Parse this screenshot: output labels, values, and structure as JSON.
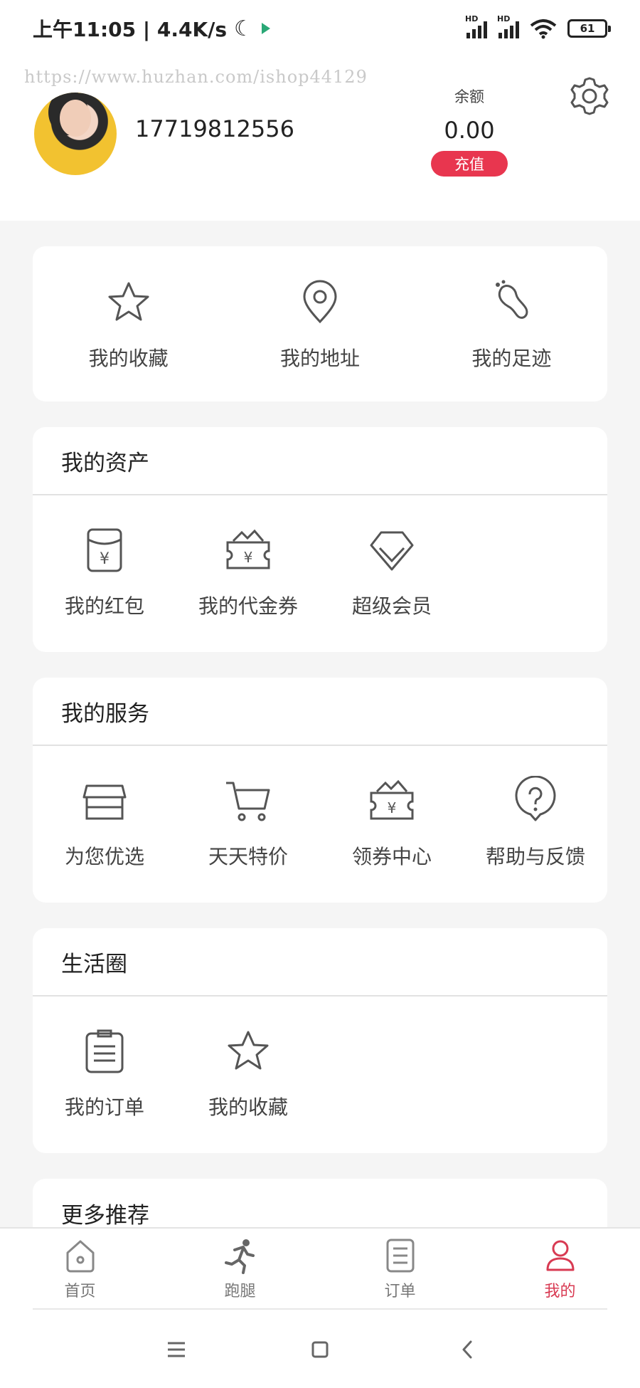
{
  "status_bar": {
    "time_speed": "上午11:05 | 4.4K/s",
    "moon_glyph": "☾",
    "battery": "61"
  },
  "watermark": "https://www.huzhan.com/ishop44129",
  "profile": {
    "phone": "17719812556",
    "balance_label": "余额",
    "balance_value": "0.00",
    "recharge_label": "充值"
  },
  "quick_links": [
    {
      "label": "我的收藏",
      "icon": "star-icon"
    },
    {
      "label": "我的地址",
      "icon": "location-pin-icon"
    },
    {
      "label": "我的足迹",
      "icon": "footprint-icon"
    }
  ],
  "assets": {
    "title": "我的资产",
    "items": [
      {
        "label": "我的红包",
        "icon": "red-packet-icon"
      },
      {
        "label": "我的代金券",
        "icon": "voucher-icon"
      },
      {
        "label": "超级会员",
        "icon": "diamond-icon"
      }
    ]
  },
  "services": {
    "title": "我的服务",
    "items": [
      {
        "label": "为您优选",
        "icon": "store-icon"
      },
      {
        "label": "天天特价",
        "icon": "cart-icon"
      },
      {
        "label": "领券中心",
        "icon": "coupon-icon"
      },
      {
        "label": "帮助与反馈",
        "icon": "help-icon"
      }
    ]
  },
  "life": {
    "title": "生活圈",
    "items": [
      {
        "label": "我的订单",
        "icon": "clipboard-icon"
      },
      {
        "label": "我的收藏",
        "icon": "star-icon"
      }
    ]
  },
  "more": {
    "title": "更多推荐"
  },
  "tabbar": [
    {
      "label": "首页",
      "icon": "home-icon"
    },
    {
      "label": "跑腿",
      "icon": "runner-icon"
    },
    {
      "label": "订单",
      "icon": "order-icon"
    },
    {
      "label": "我的",
      "icon": "user-icon",
      "active": true
    }
  ],
  "colors": {
    "accent": "#e8364f",
    "tab_active": "#d83a52",
    "icon_stroke": "#555555"
  }
}
